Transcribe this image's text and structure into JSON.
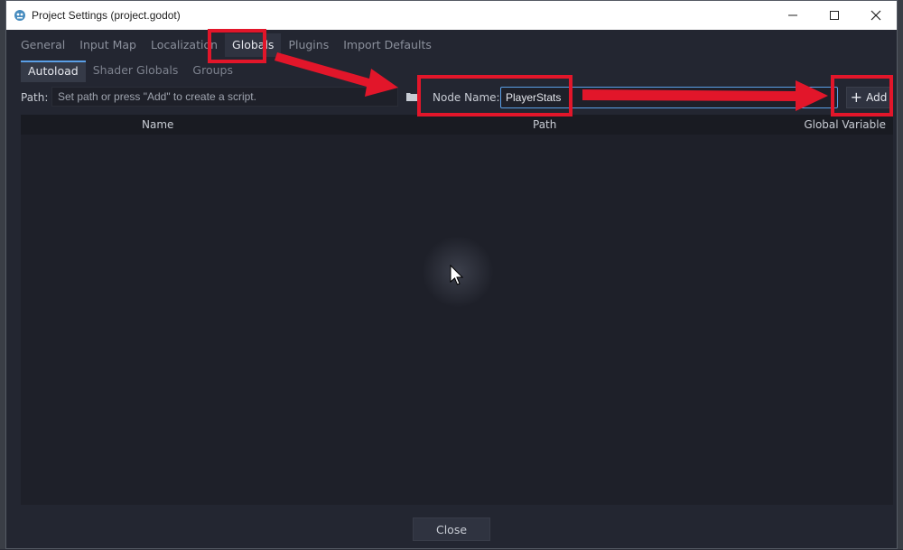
{
  "window": {
    "title": "Project Settings (project.godot)",
    "minimize_icon": "minimize-icon",
    "maximize_icon": "maximize-icon",
    "close_icon": "close-icon"
  },
  "main_tabs": [
    {
      "label": "General",
      "active": false
    },
    {
      "label": "Input Map",
      "active": false
    },
    {
      "label": "Localization",
      "active": false
    },
    {
      "label": "Globals",
      "active": true
    },
    {
      "label": "Plugins",
      "active": false
    },
    {
      "label": "Import Defaults",
      "active": false
    }
  ],
  "sub_tabs": [
    {
      "label": "Autoload",
      "active": true
    },
    {
      "label": "Shader Globals",
      "active": false
    },
    {
      "label": "Groups",
      "active": false
    }
  ],
  "autoload": {
    "path_label": "Path:",
    "path_placeholder": "Set path or press \"Add\" to create a script.",
    "path_value": "",
    "folder_icon": "folder-icon",
    "node_name_label": "Node Name:",
    "node_name_value": "PlayerStats",
    "add_label": "Add",
    "add_icon": "plus-icon"
  },
  "table": {
    "columns": [
      "Name",
      "Path",
      "Global Variable"
    ],
    "rows": []
  },
  "footer": {
    "close_label": "Close"
  },
  "annotations": {
    "highlight_color": "#e2162a"
  },
  "colors": {
    "accent": "#5a9fe6",
    "window_bg": "#232631",
    "table_bg": "#1e2029"
  }
}
